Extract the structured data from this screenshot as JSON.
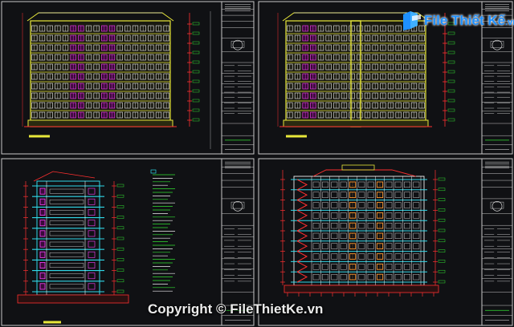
{
  "watermark": {
    "brand_main": "File",
    "brand_rest": "Thiết Kế",
    "brand_tld": ".vn",
    "copyright": "Copyright © FileThietKe.vn"
  },
  "icons": {
    "logo": "filethietke-logo-icon"
  },
  "colors": {
    "background": "#101114",
    "frame": "#c8c8c8",
    "wall_yellow": "#e8e83a",
    "window_magenta": "#ff40ff",
    "dim_red": "#ff3030",
    "cyan": "#30d8e8",
    "green": "#30e030",
    "white": "#f0f0f0",
    "brand_blue": "#1e90ff"
  }
}
